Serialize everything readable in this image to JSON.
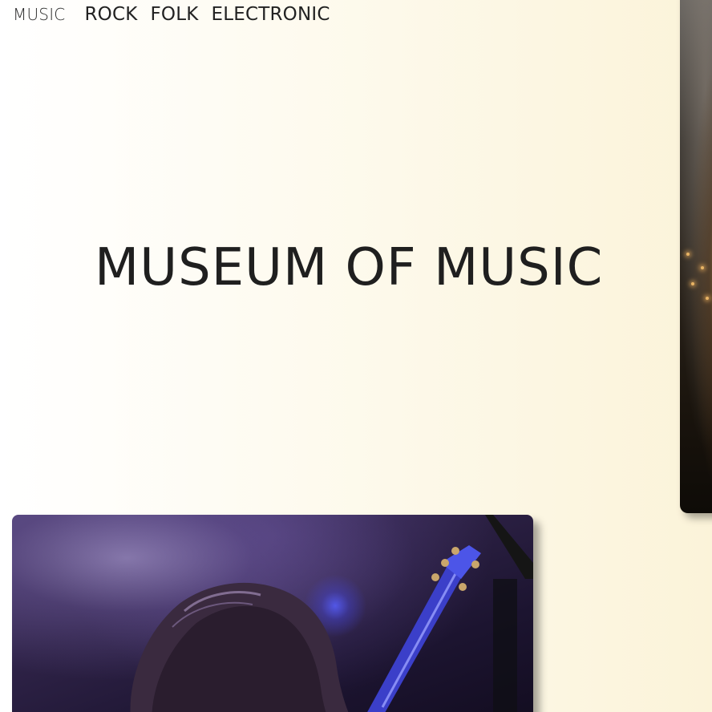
{
  "nav": {
    "brand": "MUSIC",
    "links": [
      {
        "label": "ROCK"
      },
      {
        "label": "FOLK"
      },
      {
        "label": "ELECTRONIC"
      }
    ]
  },
  "hero": {
    "title": "MUSEUM OF MUSIC"
  },
  "images": {
    "main_photo": "guitarist-photo",
    "side_photo": "concert-crowd-photo"
  },
  "colors": {
    "background_start": "#ffffff",
    "background_end": "#fbf3d9",
    "text": "#222222"
  }
}
